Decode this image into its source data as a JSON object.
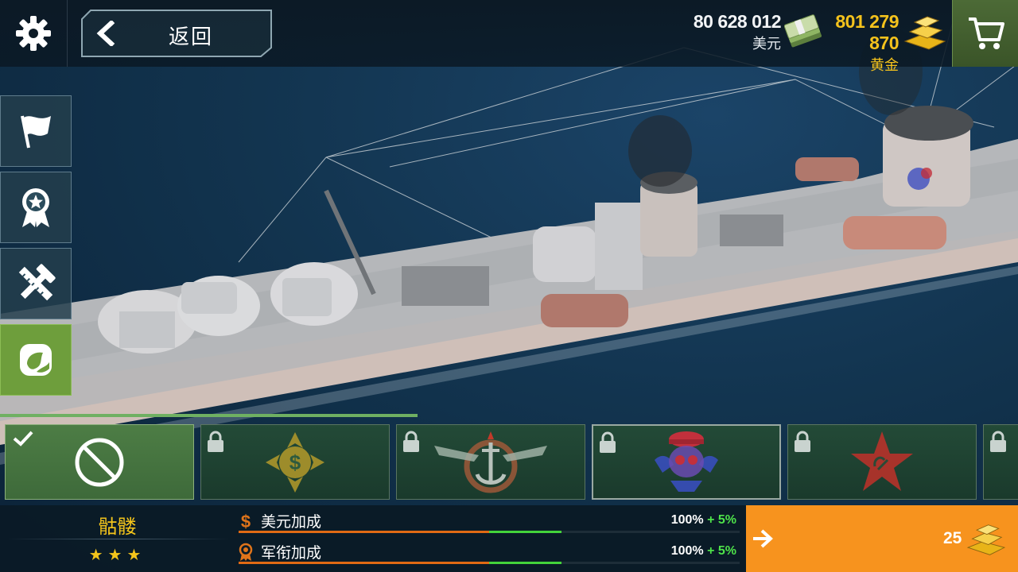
{
  "header": {
    "back_label": "返回",
    "usd_amount": "80 628 012",
    "usd_name": "美元",
    "gold_amount": "801 279 870",
    "gold_name": "黄金"
  },
  "icons": {
    "settings": "gear-icon",
    "back": "chevron-left-icon",
    "cash": "cash-stack-icon",
    "gold": "gold-bars-icon",
    "cart": "shopping-cart-icon",
    "flag": "flag-icon",
    "medal": "medal-icon",
    "upgrade": "hammer-ruler-icon",
    "camo": "camouflage-icon",
    "lock": "lock-icon",
    "check": "check-icon",
    "none": "no-symbol-icon",
    "buy_arrow": "arrow-right-icon"
  },
  "side_menu": [
    "flag",
    "medal",
    "upgrade",
    "camo"
  ],
  "side_menu_active": "camo",
  "camo_progress": 0.41,
  "skins": [
    {
      "id": "none",
      "emblem": "no-symbol-icon",
      "locked": false,
      "selected": true
    },
    {
      "id": "dollar",
      "emblem": "dollar-cross-emblem-icon",
      "locked": true
    },
    {
      "id": "navy",
      "emblem": "anchor-wings-emblem-icon",
      "locked": true
    },
    {
      "id": "skull",
      "emblem": "skull-emblem-icon",
      "locked": true,
      "highlighted": true
    },
    {
      "id": "soviet",
      "emblem": "red-star-emblem-icon",
      "locked": true
    },
    {
      "id": "partial",
      "emblem": "",
      "locked": true
    }
  ],
  "skin_info": {
    "name": "骷髅",
    "stars": "★★★"
  },
  "bonuses": [
    {
      "label": "美元加成",
      "icon": "dollar-sign-icon",
      "base": "100%",
      "plus": "+ 5%",
      "base_fraction": 0.5,
      "extra_fraction": 0.02
    },
    {
      "label": "军衔加成",
      "icon": "rank-medal-icon",
      "base": "100%",
      "plus": "+ 5%",
      "base_fraction": 0.5,
      "extra_fraction": 0.02
    }
  ],
  "buy": {
    "price": "25"
  },
  "colors": {
    "gold_text": "#f4c21c",
    "buy_orange": "#f7931e",
    "active_green": "#6e9e3c",
    "bonus_orange": "#e06a14",
    "bonus_green": "#43d33b"
  }
}
